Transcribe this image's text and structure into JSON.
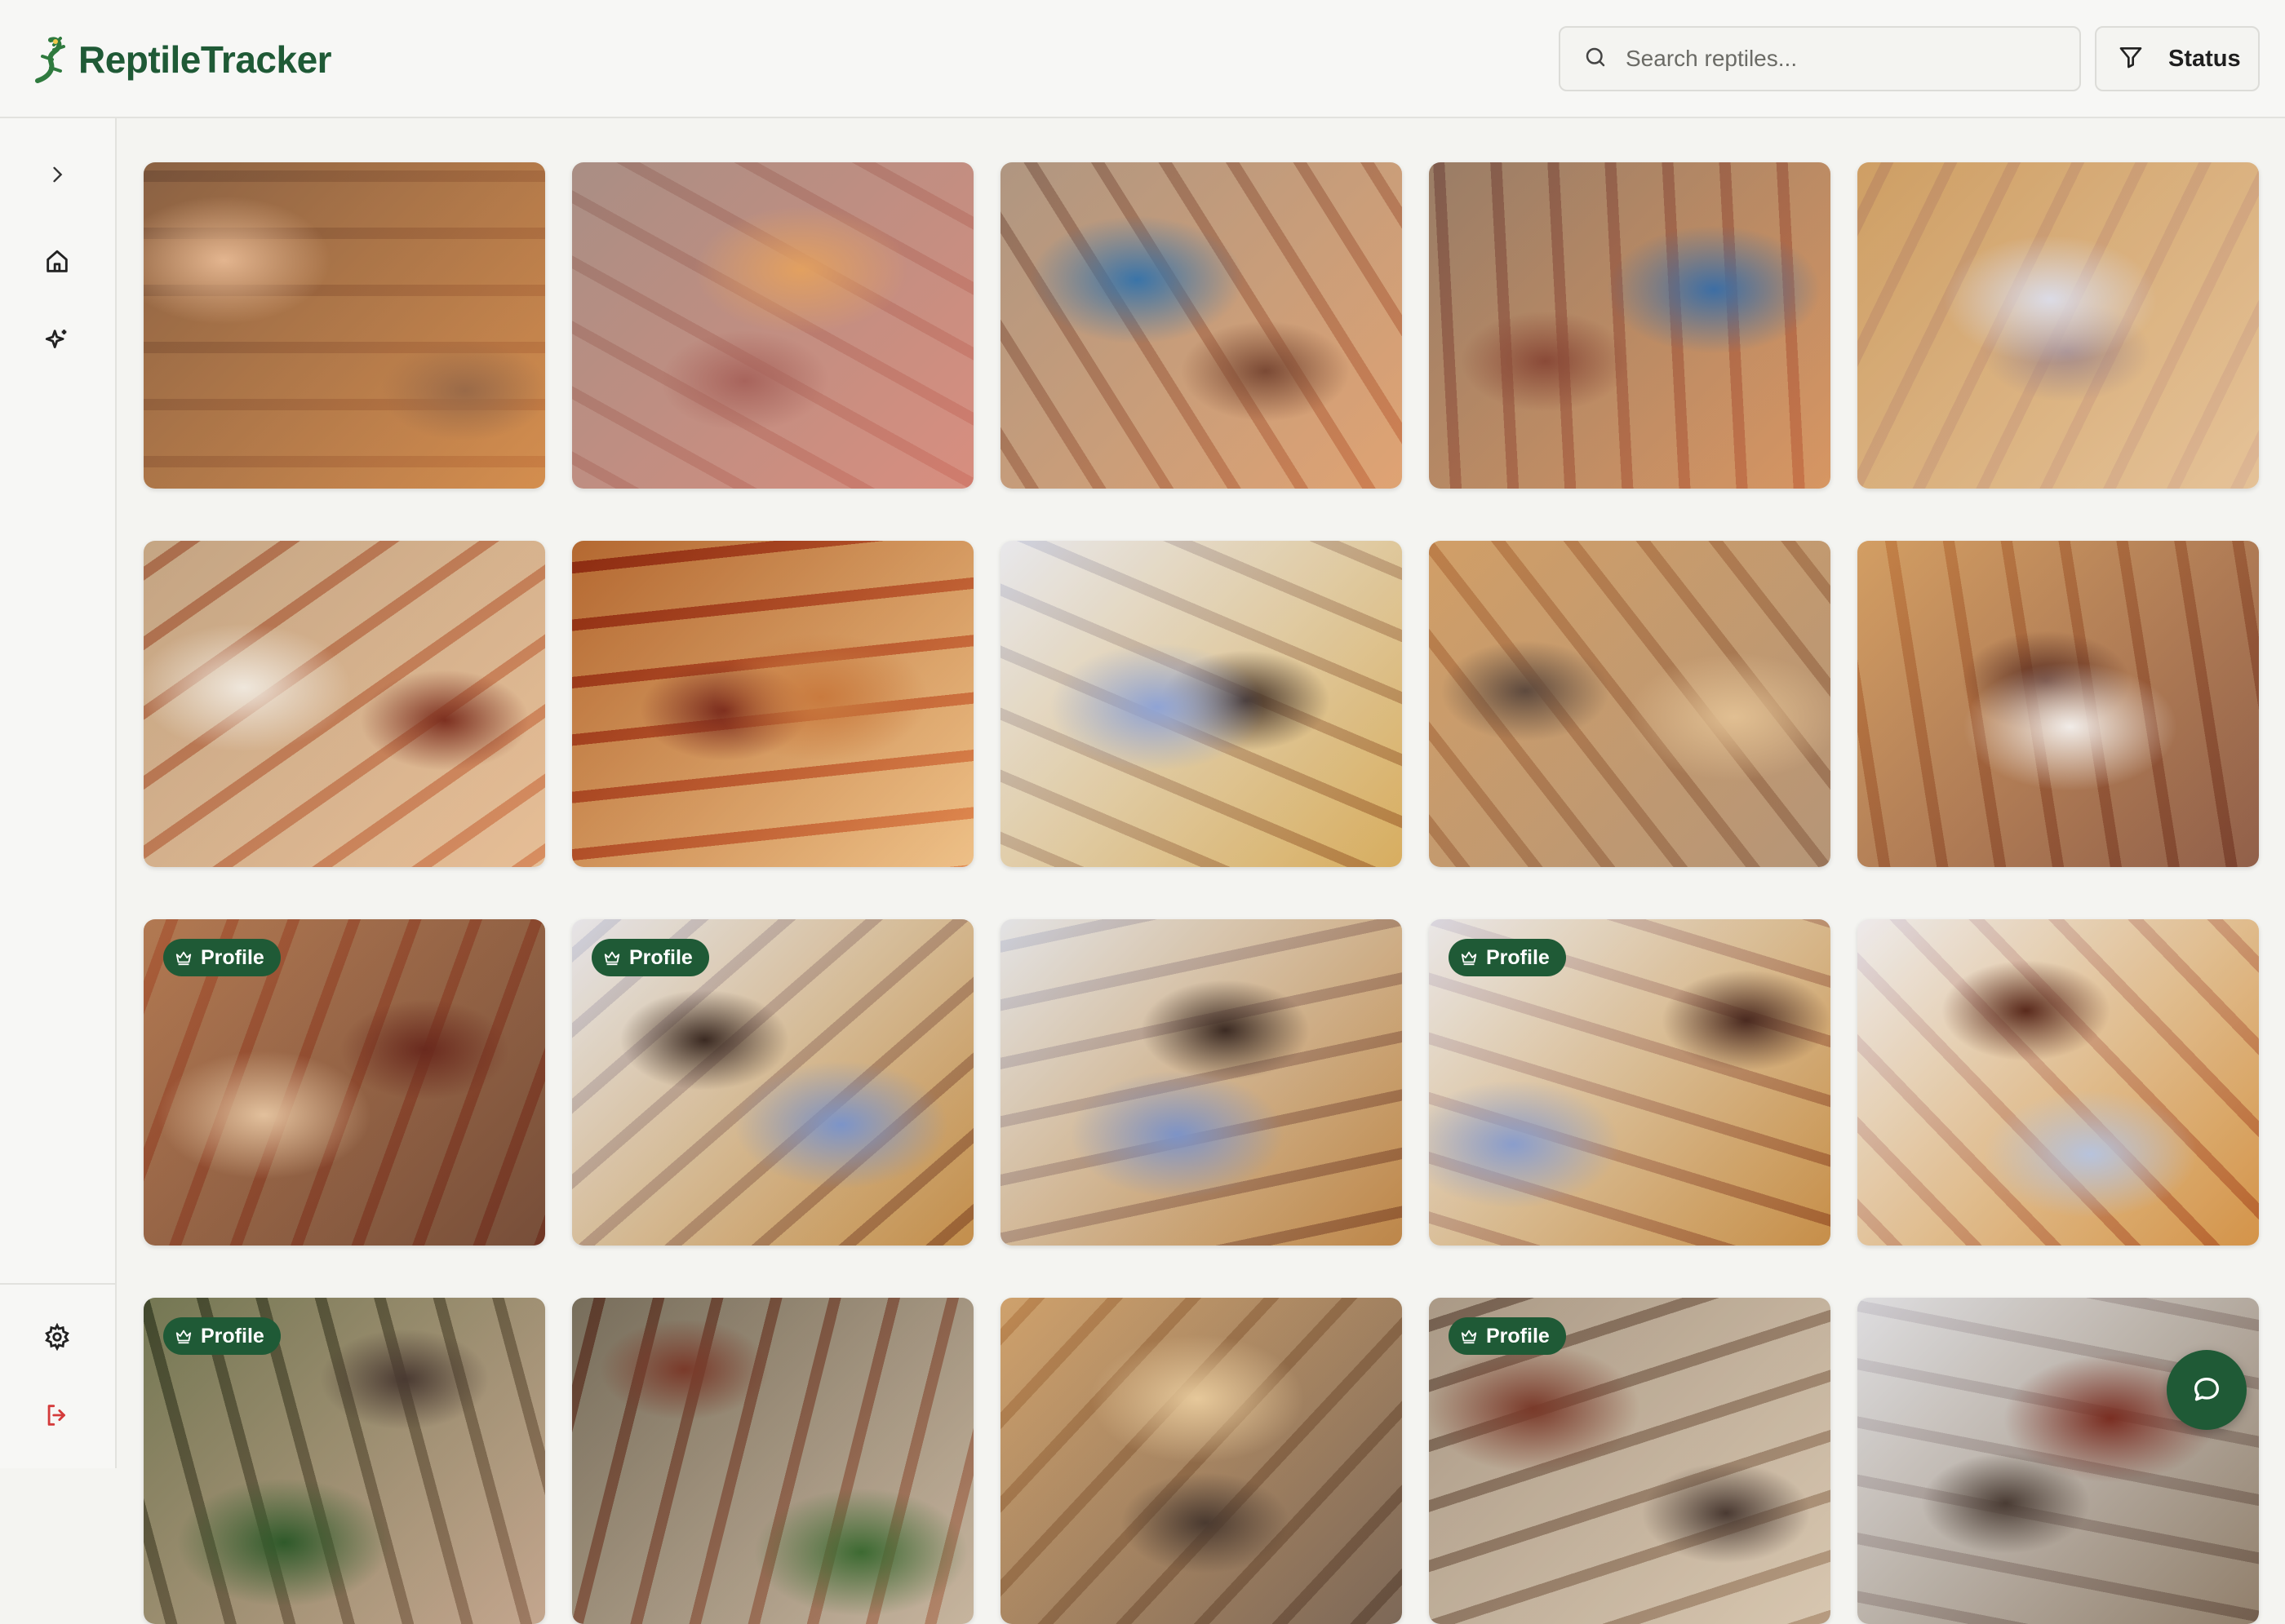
{
  "app": {
    "title": "ReptileTracker",
    "brand_color": "#1f5a36"
  },
  "search": {
    "placeholder": "Search reptiles..."
  },
  "filter": {
    "label": "Status"
  },
  "sidebar": {
    "items": [
      {
        "name": "expand",
        "icon": "chevron-right-icon"
      },
      {
        "name": "home",
        "icon": "home-icon"
      },
      {
        "name": "ai",
        "icon": "sparkles-icon"
      },
      {
        "name": "settings",
        "icon": "gear-icon"
      },
      {
        "name": "logout",
        "icon": "logout-icon"
      }
    ]
  },
  "badge_label": "Profile",
  "gallery": [
    {
      "profile": false,
      "palette": [
        "#6a5c52",
        "#c58a5e",
        "#9a6a48",
        "#e3b58f"
      ]
    },
    {
      "profile": false,
      "palette": [
        "#8d8a84",
        "#c98a7f",
        "#a8645c",
        "#e2a060"
      ]
    },
    {
      "profile": false,
      "palette": [
        "#918c85",
        "#d19a77",
        "#7b4a35",
        "#3a74a8"
      ]
    },
    {
      "profile": false,
      "palette": [
        "#7b7670",
        "#c8906c",
        "#8a4a38",
        "#3d6ea4"
      ]
    },
    {
      "profile": false,
      "palette": [
        "#b78a5c",
        "#d8b491",
        "#a48a8a",
        "#dbdbe6"
      ]
    },
    {
      "profile": false,
      "palette": [
        "#a9937c",
        "#d9b090",
        "#7d3020",
        "#efe7dc"
      ]
    },
    {
      "profile": false,
      "palette": [
        "#8e4f2e",
        "#e3b285",
        "#7a2a1c",
        "#c97a3e"
      ]
    },
    {
      "profile": false,
      "palette": [
        "#dfe4ee",
        "#c9a26a",
        "#3f2d22",
        "#8fa3d4"
      ]
    },
    {
      "profile": false,
      "palette": [
        "#c8996a",
        "#a98f7a",
        "#5e4a3e",
        "#e1bf92"
      ]
    },
    {
      "profile": false,
      "palette": [
        "#d1a876",
        "#8c6a5a",
        "#5a2e22",
        "#f1ece8"
      ]
    },
    {
      "profile": true,
      "palette": [
        "#b48a6a",
        "#7a5e4e",
        "#6a2a1e",
        "#e2c09c"
      ]
    },
    {
      "profile": true,
      "palette": [
        "#dfe3ec",
        "#b58a5c",
        "#3b2a22",
        "#7c94c8"
      ]
    },
    {
      "profile": false,
      "palette": [
        "#dde2ea",
        "#b0845a",
        "#3c2b23",
        "#7d93c6"
      ]
    },
    {
      "profile": true,
      "palette": [
        "#e4e6ec",
        "#b88a5a",
        "#4a2a20",
        "#8a9dcb"
      ]
    },
    {
      "profile": false,
      "palette": [
        "#e7e9ef",
        "#c58e5a",
        "#5a2a1c",
        "#b7c3dc"
      ]
    },
    {
      "profile": true,
      "palette": [
        "#5a6a4e",
        "#b59c8a",
        "#4a3a32",
        "#2f5a2a"
      ]
    },
    {
      "profile": false,
      "palette": [
        "#5c5a50",
        "#b8a896",
        "#7a3a2a",
        "#3d6a32"
      ]
    },
    {
      "profile": false,
      "palette": [
        "#cfa87a",
        "#7e7064",
        "#4a3a30",
        "#e6c89a"
      ]
    },
    {
      "profile": true,
      "palette": [
        "#8e8276",
        "#c9b8a4",
        "#4a3a32",
        "#7a3a2a"
      ]
    },
    {
      "profile": false,
      "palette": [
        "#dcdde2",
        "#8c7f72",
        "#4a3c34",
        "#7a2e22"
      ]
    }
  ]
}
